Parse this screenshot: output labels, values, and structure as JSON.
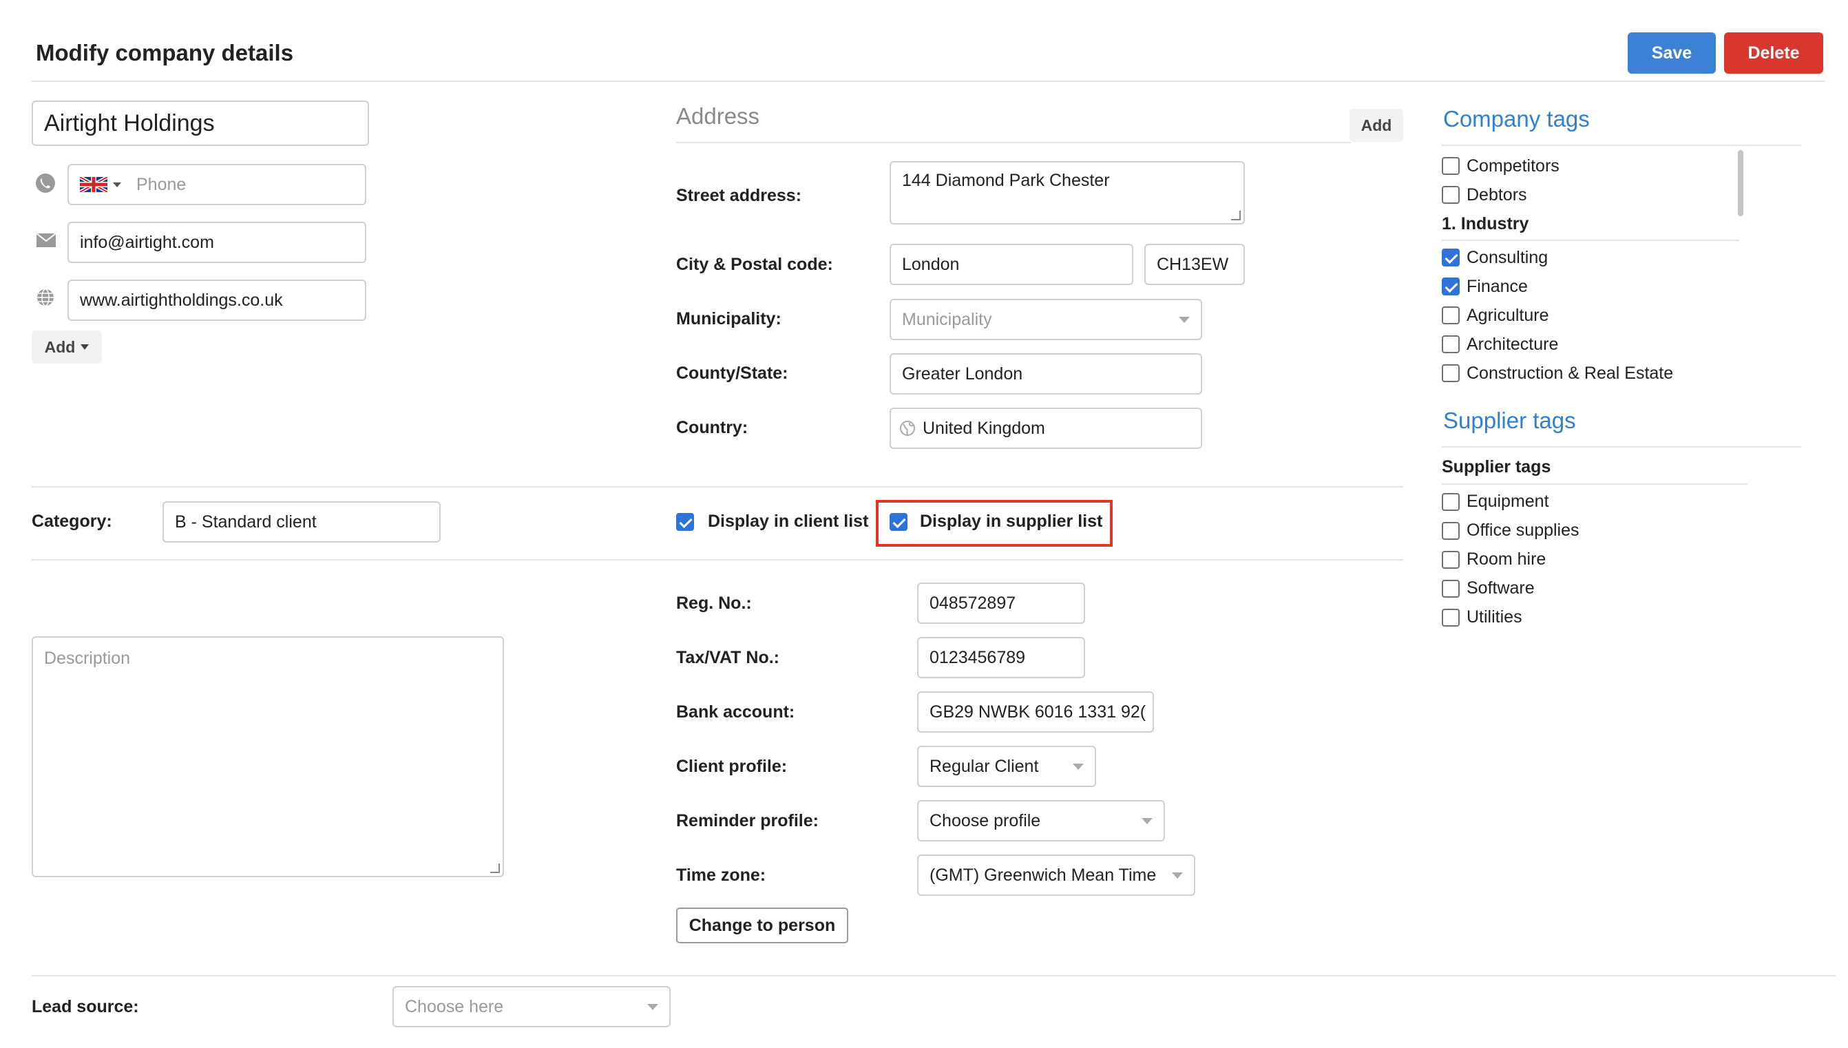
{
  "header": {
    "title": "Modify company details",
    "save_label": "Save",
    "delete_label": "Delete"
  },
  "company": {
    "name": "Airtight Holdings",
    "phone_placeholder": "Phone",
    "email": "info@airtight.com",
    "website": "www.airtightholdings.co.uk",
    "add_label": "Add"
  },
  "address": {
    "title": "Address",
    "add_label": "Add",
    "street_label": "Street address:",
    "street_value": "144 Diamond Park Chester",
    "city_label": "City & Postal code:",
    "city_value": "London",
    "postal_value": "CH13EW",
    "municipality_label": "Municipality:",
    "municipality_placeholder": "Municipality",
    "county_label": "County/State:",
    "county_value": "Greater London",
    "country_label": "Country:",
    "country_value": "United Kingdom"
  },
  "category": {
    "label": "Category:",
    "value": "B - Standard client",
    "client_list_label": "Display in client list",
    "supplier_list_label": "Display in supplier list",
    "client_list_checked": true,
    "supplier_list_checked": true
  },
  "description_placeholder": "Description",
  "details": {
    "reg_label": "Reg. No.:",
    "reg_value": "048572897",
    "tax_label": "Tax/VAT No.:",
    "tax_value": "0123456789",
    "bank_label": "Bank account:",
    "bank_value": "GB29 NWBK 6016 1331 92(",
    "client_profile_label": "Client profile:",
    "client_profile_value": "Regular Client",
    "reminder_label": "Reminder profile:",
    "reminder_value": "Choose profile",
    "timezone_label": "Time zone:",
    "timezone_value": "(GMT) Greenwich Mean Time",
    "change_person_label": "Change to person"
  },
  "lead": {
    "label": "Lead source:",
    "placeholder": "Choose here"
  },
  "company_tags": {
    "title": "Company tags",
    "items": [
      {
        "label": "Competitors",
        "checked": false
      },
      {
        "label": "Debtors",
        "checked": false
      }
    ],
    "group_label": "1. Industry",
    "group_items": [
      {
        "label": "Consulting",
        "checked": true
      },
      {
        "label": "Finance",
        "checked": true
      },
      {
        "label": "Agriculture",
        "checked": false
      },
      {
        "label": "Architecture",
        "checked": false
      },
      {
        "label": "Construction & Real Estate",
        "checked": false
      }
    ]
  },
  "supplier_tags": {
    "title": "Supplier tags",
    "group_label": "Supplier tags",
    "items": [
      {
        "label": "Equipment",
        "checked": false
      },
      {
        "label": "Office supplies",
        "checked": false
      },
      {
        "label": "Room hire",
        "checked": false
      },
      {
        "label": "Software",
        "checked": false
      },
      {
        "label": "Utilities",
        "checked": false
      }
    ]
  },
  "colors": {
    "primary": "#3b82d6",
    "danger": "#d9372d",
    "tag_heading": "#2f80d1",
    "highlight": "#e0372a"
  }
}
